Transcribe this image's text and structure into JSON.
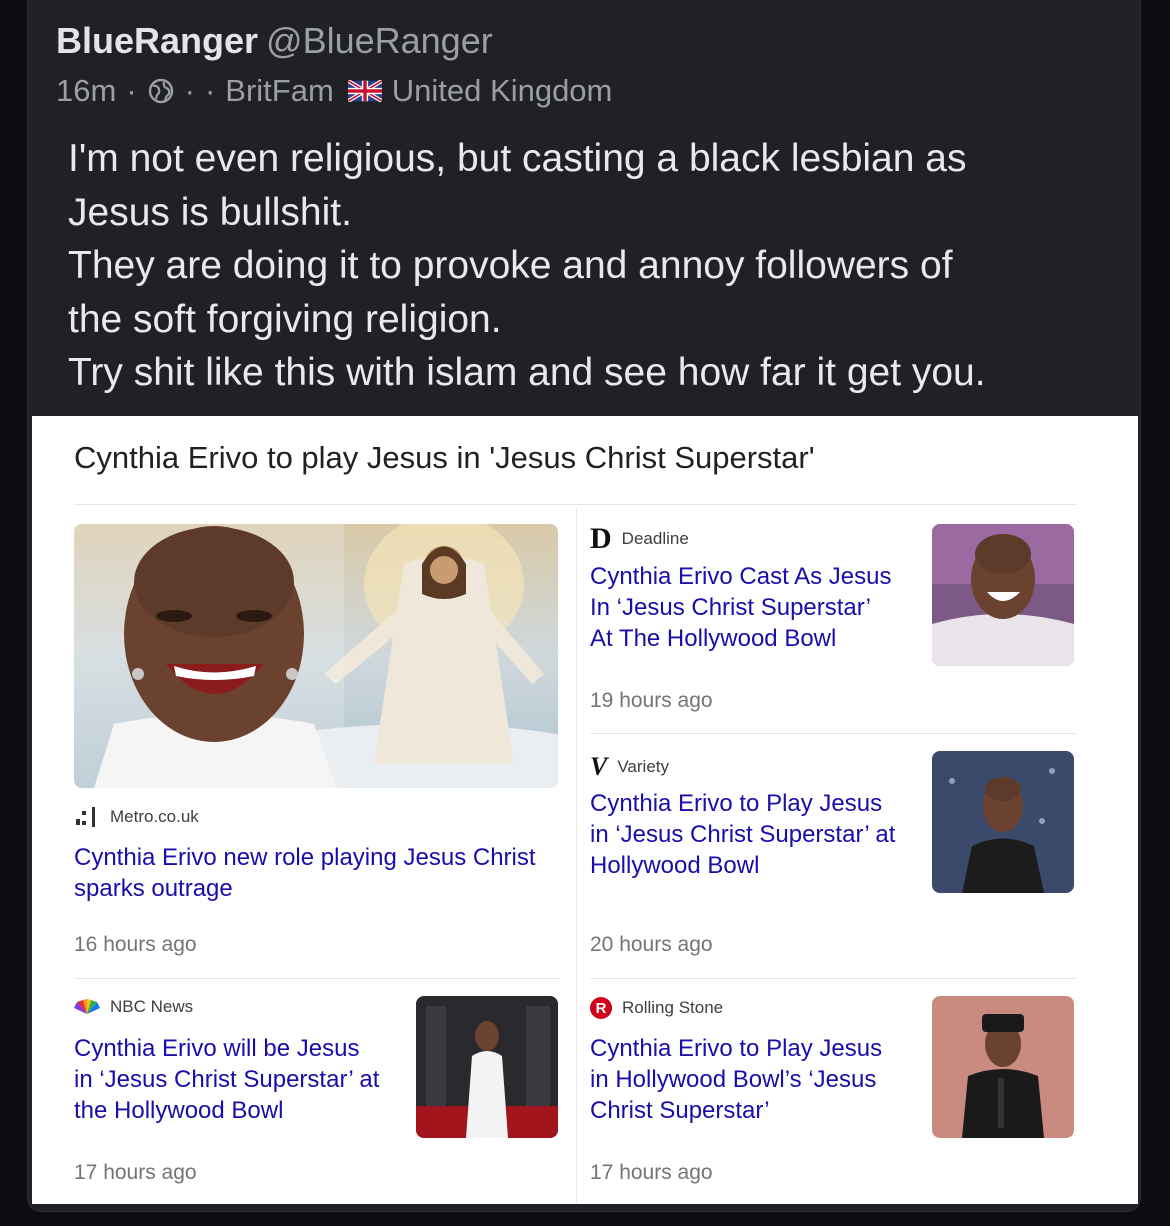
{
  "post": {
    "author_name": "BlueRanger",
    "author_handle": "@BlueRanger",
    "time": "16m",
    "community": "BritFam",
    "location": "United Kingdom",
    "text_lines": [
      "I'm not even religious, but casting a black lesbian as",
      "Jesus is bullshit.",
      "They are doing it to provoke and annoy followers of",
      "the soft forgiving religion.",
      "Try shit like this with islam and see how far it get you."
    ]
  },
  "card": {
    "headline": "Cynthia Erivo to play Jesus in 'Jesus Christ Superstar'",
    "stories": [
      {
        "source": "Metro.co.uk",
        "title_lines": [
          "Cynthia Erivo new role playing Jesus Christ",
          "sparks outrage"
        ],
        "time": "16 hours ago"
      },
      {
        "source": "Deadline",
        "logo_letter": "D",
        "title_lines": [
          "Cynthia Erivo Cast As Jesus",
          "In ‘Jesus Christ Superstar’",
          "At The Hollywood Bowl"
        ],
        "time": "19 hours ago"
      },
      {
        "source": "Variety",
        "logo_letter": "V",
        "title_lines": [
          "Cynthia Erivo to Play Jesus",
          "in ‘Jesus Christ Superstar’ at",
          "Hollywood Bowl"
        ],
        "time": "20 hours ago"
      },
      {
        "source": "NBC News",
        "title_lines": [
          "Cynthia Erivo will be Jesus",
          "in ‘Jesus Christ Superstar’ at",
          "the Hollywood Bowl"
        ],
        "time": "17 hours ago"
      },
      {
        "source": "Rolling Stone",
        "logo_letter": "R",
        "title_lines": [
          "Cynthia Erivo to Play Jesus",
          "in Hollywood Bowl’s ‘Jesus",
          "Christ Superstar’"
        ],
        "time": "17 hours ago"
      }
    ]
  }
}
